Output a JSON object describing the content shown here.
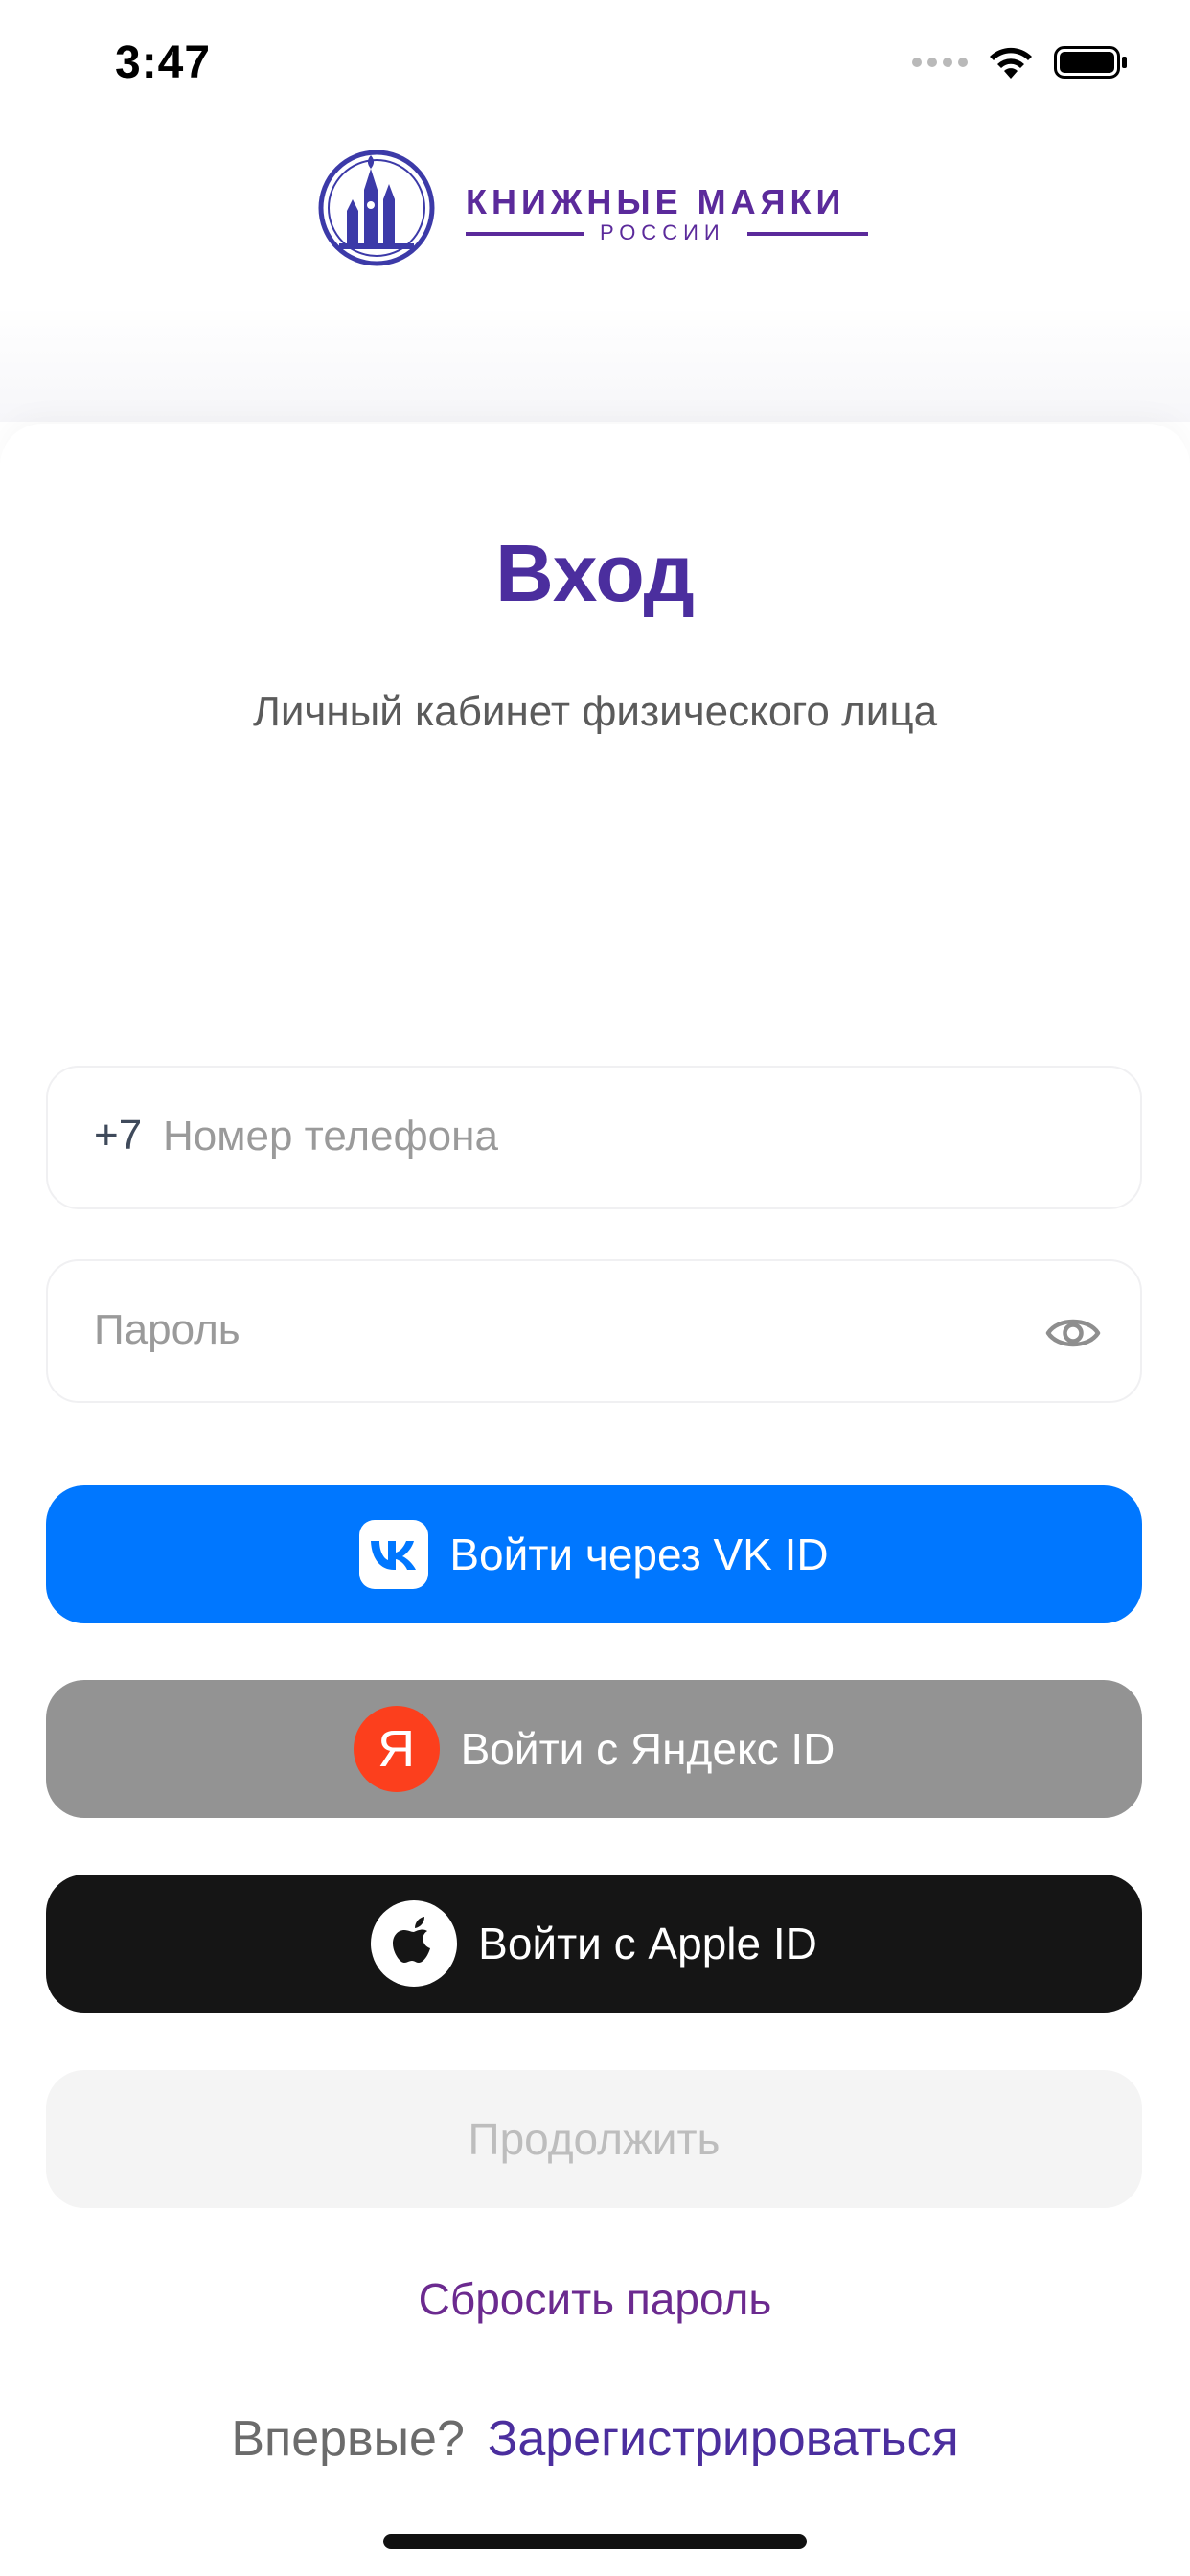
{
  "status_bar": {
    "time": "3:47"
  },
  "logo": {
    "title": "КНИЖНЫЕ МАЯКИ",
    "subtitle": "РОССИИ",
    "brand_color": "#5b2a9b"
  },
  "login": {
    "title": "Вход",
    "subtitle": "Личный кабинет физического лица"
  },
  "phone_field": {
    "prefix": "+7",
    "placeholder": "Номер телефона",
    "value": ""
  },
  "password_field": {
    "placeholder": "Пароль",
    "value": "",
    "toggle_icon": "eye-icon"
  },
  "buttons": {
    "vk": {
      "label": "Войти через VK ID",
      "icon": "vk-logo-icon",
      "color": "#0077ff"
    },
    "yandex": {
      "label": "Войти с Яндекс ID",
      "icon_glyph": "Я",
      "color": "#939393"
    },
    "apple": {
      "label": "Войти с Apple ID",
      "icon": "apple-logo-icon",
      "color": "#151515"
    },
    "continue": {
      "label": "Продолжить"
    }
  },
  "links": {
    "reset_password": "Сбросить пароль",
    "register_question": "Впервые?",
    "register": "Зарегистрироваться"
  }
}
